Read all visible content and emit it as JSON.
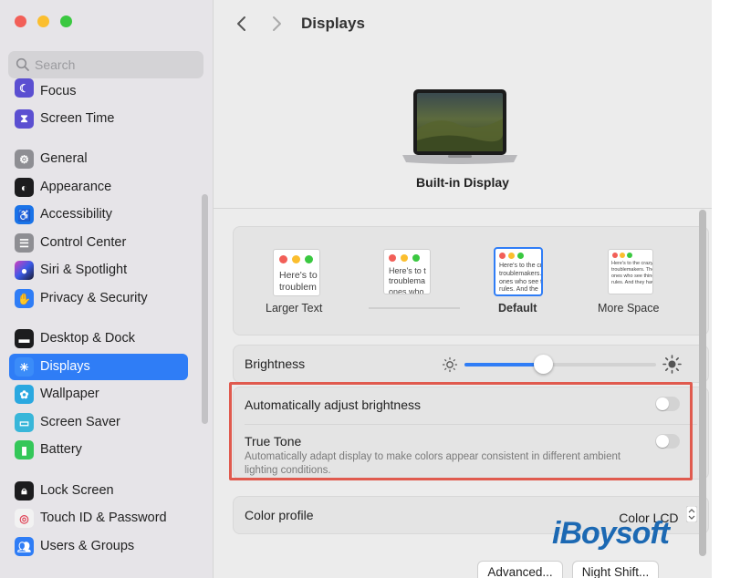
{
  "colors": {
    "accent": "#2f7df6",
    "traffic_red": "#f25f58",
    "traffic_yellow": "#fbbe2e",
    "traffic_green": "#3ac840",
    "highlight": "#e05a4e",
    "watermark": "#1c69b3"
  },
  "sidebar": {
    "search_placeholder": "Search",
    "items": [
      {
        "label": "Focus",
        "icon": "moon-icon"
      },
      {
        "label": "Screen Time",
        "icon": "hourglass-icon"
      },
      {
        "label": "General",
        "icon": "gear-icon"
      },
      {
        "label": "Appearance",
        "icon": "appearance-icon"
      },
      {
        "label": "Accessibility",
        "icon": "accessibility-icon"
      },
      {
        "label": "Control Center",
        "icon": "control-center-icon"
      },
      {
        "label": "Siri & Spotlight",
        "icon": "siri-icon"
      },
      {
        "label": "Privacy & Security",
        "icon": "hand-icon"
      },
      {
        "label": "Desktop & Dock",
        "icon": "dock-icon"
      },
      {
        "label": "Displays",
        "icon": "sun-icon"
      },
      {
        "label": "Wallpaper",
        "icon": "flower-icon"
      },
      {
        "label": "Screen Saver",
        "icon": "screen-saver-icon"
      },
      {
        "label": "Battery",
        "icon": "battery-icon"
      },
      {
        "label": "Lock Screen",
        "icon": "lock-icon"
      },
      {
        "label": "Touch ID & Password",
        "icon": "fingerprint-icon"
      },
      {
        "label": "Users & Groups",
        "icon": "users-icon"
      }
    ],
    "selected": "Displays"
  },
  "header": {
    "title": "Displays"
  },
  "display": {
    "name": "Built-in Display"
  },
  "resolution": {
    "options": [
      {
        "label": "Larger Text",
        "preview": "Here's to\ntroublem"
      },
      {
        "label": "",
        "preview": "Here's to t\ntroublema\nones who"
      },
      {
        "label": "Default",
        "preview": "Here's to the cr\ntroublemakers.\nones who see t\nrules. And the"
      },
      {
        "label": "More Space",
        "preview": "Here's to the crazy o\ntroublemakers. The r\nones who see things d\nrules. And they have"
      }
    ],
    "selected": "Default"
  },
  "brightness": {
    "label": "Brightness",
    "value": 0.41
  },
  "auto_brightness": {
    "label": "Automatically adjust brightness",
    "enabled": false
  },
  "true_tone": {
    "label": "True Tone",
    "description": "Automatically adapt display to make colors appear consistent in different ambient lighting conditions.",
    "enabled": false
  },
  "color_profile": {
    "label": "Color profile",
    "value": "Color LCD"
  },
  "buttons": {
    "advanced": "Advanced...",
    "night_shift": "Night Shift..."
  },
  "watermark": "iBoysoft"
}
